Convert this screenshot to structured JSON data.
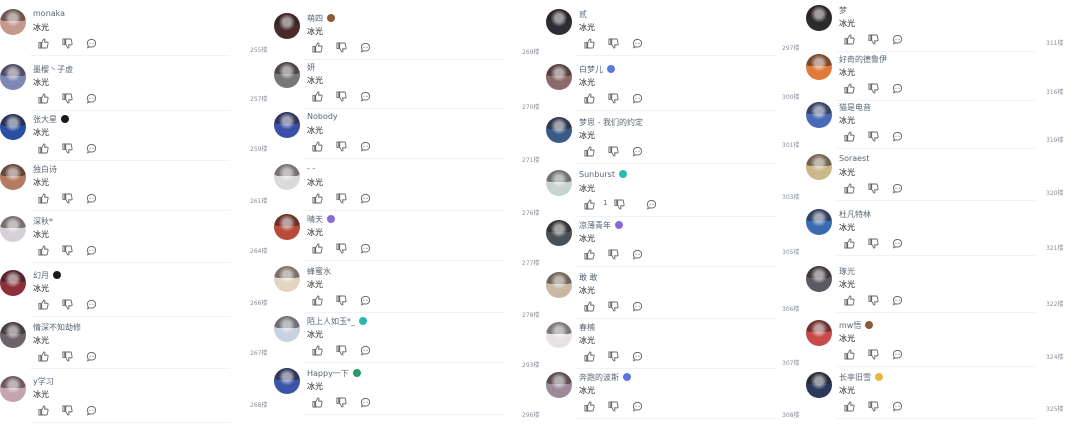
{
  "comment_text": "冰光",
  "columns": [
    {
      "comments": [
        {
          "user": "monaka",
          "badge": "",
          "avatar": "#c49a90",
          "floor": ""
        },
        {
          "user": "墨樱丶子虚",
          "badge": "",
          "avatar": "#7d88b7",
          "floor": ""
        },
        {
          "user": "张大星",
          "badge": "black",
          "avatar": "#2a4fa0",
          "floor": ""
        },
        {
          "user": "独白诗",
          "badge": "",
          "avatar": "#b57a62",
          "floor": ""
        },
        {
          "user": "深秋*",
          "badge": "",
          "avatar": "#d4d0d6",
          "floor": ""
        },
        {
          "user": "幻月",
          "badge": "black",
          "avatar": "#8b2f3a",
          "floor": ""
        },
        {
          "user": "情深不知劫修",
          "badge": "",
          "avatar": "#6d6369",
          "floor": ""
        },
        {
          "user": "y学习",
          "badge": "",
          "avatar": "#c4a3b0",
          "floor": ""
        }
      ]
    },
    {
      "comments": [
        {
          "user": "萌四",
          "badge": "brown",
          "avatar": "#4a2a2a",
          "floor": "255楼"
        },
        {
          "user": "妍",
          "badge": "",
          "avatar": "#777777",
          "floor": "257楼"
        },
        {
          "user": "Nobody",
          "badge": "",
          "avatar": "#3b4fa8",
          "floor": "259楼"
        },
        {
          "user": "- -",
          "badge": "",
          "avatar": "#dadada",
          "floor": "261楼"
        },
        {
          "user": "晴天",
          "badge": "purple",
          "avatar": "#b84a3a",
          "floor": "264楼"
        },
        {
          "user": "蜂蜜水",
          "badge": "",
          "avatar": "#e3d6c0",
          "floor": "266楼"
        },
        {
          "user": "陌上人如玉*_",
          "badge": "teal",
          "avatar": "#c8d2e0",
          "floor": "267楼"
        },
        {
          "user": "Happy一下",
          "badge": "green",
          "avatar": "#3a55a8",
          "floor": "268楼"
        }
      ]
    },
    {
      "comments": [
        {
          "user": "贰",
          "badge": "",
          "avatar": "#2d2d35",
          "floor": "269楼"
        },
        {
          "user": "白梦儿",
          "badge": "blue",
          "avatar": "#8a6b6a",
          "floor": "270楼"
        },
        {
          "user": "梦思 - 我们的约定",
          "badge": "",
          "avatar": "#3a5a88",
          "floor": "271楼"
        },
        {
          "user": "Sunburst",
          "badge": "teal",
          "avatar": "#c8d4d0",
          "floor": "276楼"
        },
        {
          "user": "凉薄青年",
          "badge": "purple",
          "avatar": "#4a5058",
          "floor": "277楼"
        },
        {
          "user": "敢 敢",
          "badge": "",
          "avatar": "#c9b8a3",
          "floor": "278楼"
        },
        {
          "user": "春楠",
          "badge": "",
          "avatar": "#e6e2e6",
          "floor": "293楼"
        },
        {
          "user": "奔跑的波斯",
          "badge": "blue",
          "avatar": "#9a8a9a",
          "floor": "296楼"
        }
      ]
    },
    {
      "comments": [
        {
          "user": "梦",
          "badge": "",
          "avatar": "#2b2b2b",
          "floor": "297楼"
        },
        {
          "user": "好奇的德鲁伊",
          "badge": "",
          "avatar": "#e07a3a",
          "floor": "300楼"
        },
        {
          "user": "猫是电音",
          "badge": "",
          "avatar": "#4a6ab8",
          "floor": "301楼"
        },
        {
          "user": "Soraest",
          "badge": "",
          "avatar": "#c9b88a",
          "floor": "303楼"
        },
        {
          "user": "杜凡特林",
          "badge": "",
          "avatar": "#3a6ab0",
          "floor": "305楼"
        },
        {
          "user": "琢光",
          "badge": "",
          "avatar": "#5a5a60",
          "floor": "306楼"
        },
        {
          "user": "mw悟",
          "badge": "brown",
          "avatar": "#c84a4a",
          "floor": "307楼"
        },
        {
          "user": "长亭旧雪",
          "badge": "yellow",
          "avatar": "#2a3a5a",
          "floor": "308楼"
        }
      ]
    }
  ],
  "right_floors": [
    "311楼",
    "316楼",
    "319楼",
    "320楼",
    "321楼",
    "322楼",
    "324楼",
    "325楼"
  ],
  "likes_badge": {
    "column": 2,
    "row": 3,
    "value": "1"
  },
  "colors": {
    "black": "#1a1a1a",
    "brown": "#8a5a3a",
    "purple": "#8a6ad8",
    "teal": "#2ab8b0",
    "green": "#2a9a6a",
    "blue": "#5a7ad8",
    "yellow": "#e8b840"
  }
}
